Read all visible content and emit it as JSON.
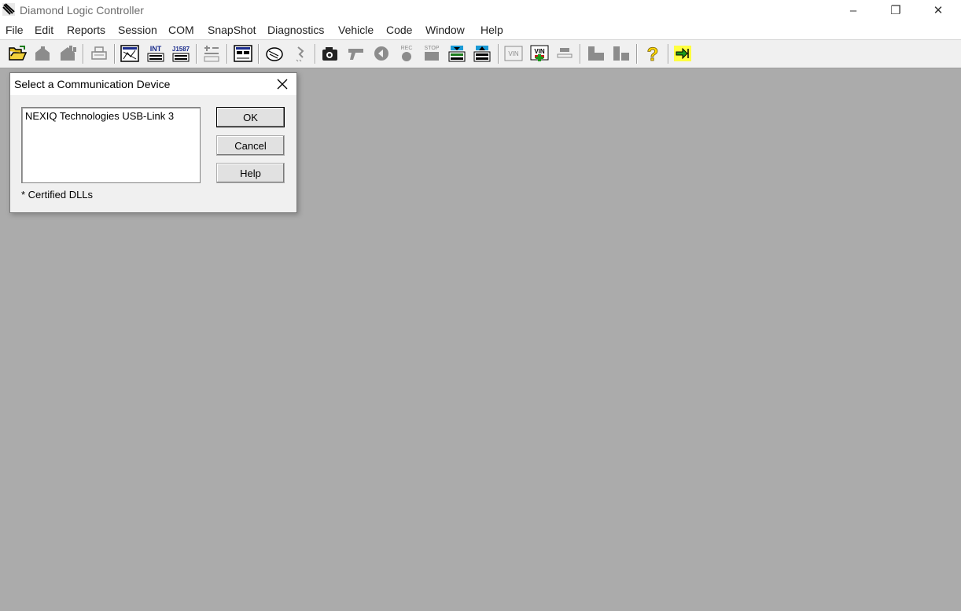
{
  "window": {
    "title": "Diamond Logic Controller",
    "minimize": "–",
    "restore": "❐",
    "close": "✕"
  },
  "menu": [
    "File",
    "Edit",
    "Reports",
    "Session",
    "COM",
    "SnapShot",
    "Diagnostics",
    "Vehicle",
    "Code",
    "Window",
    "Help"
  ],
  "toolbar": {
    "int_label": "INT",
    "j1587_label": "J1587",
    "rec_label": "REC",
    "stop_label": "STOP",
    "vin_label": "VIN",
    "help_glyph": "?"
  },
  "dialog": {
    "title": "Select a Communication Device",
    "devices": [
      "NEXIQ Technologies USB-Link 3"
    ],
    "ok_label": "OK",
    "cancel_label": "Cancel",
    "help_label": "Help",
    "note": "* Certified DLLs"
  },
  "colors": {
    "workspace": "#ababab",
    "dialog_bg": "#f0f0f0",
    "help_icon": "#ffd800"
  }
}
